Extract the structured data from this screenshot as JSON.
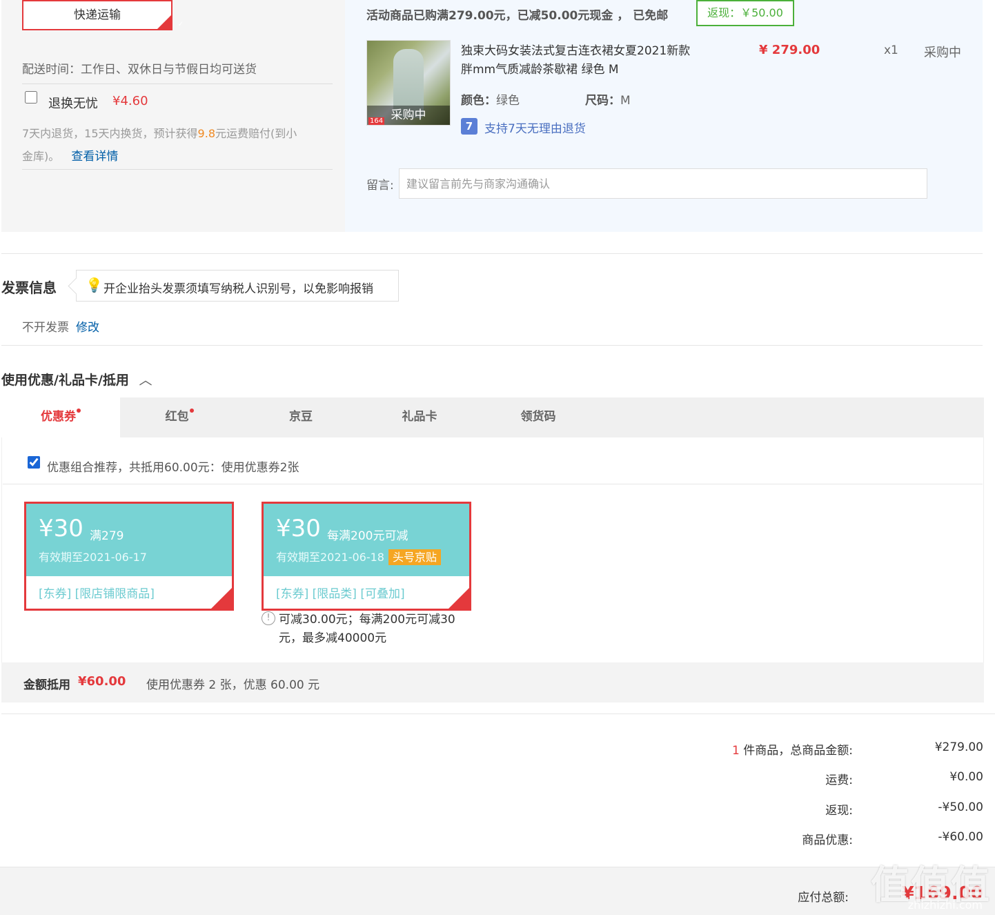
{
  "shipping": {
    "method_label": "快递运输",
    "delivery_time": "配送时间：工作日、双休日与节假日均可送货",
    "return_service_label": "退换无忧",
    "return_service_price": "¥4.60",
    "return_desc_prefix": "7天内退货，15天内换货，预计获得",
    "return_desc_amount": "9.8",
    "return_desc_suffix": "元运费赔付(到小",
    "return_desc_line2": "金库)。",
    "details_link": "查看详情"
  },
  "promo": {
    "title": "活动商品已购满279.00元，已减50.00元现金 ， 已免邮",
    "cashback": "返现：￥50.00"
  },
  "product": {
    "thumb_overlay": "采购中",
    "thumb_tag": "164",
    "name_line1": "独束大码女装法式复古连衣裙女夏2021新款",
    "name_line2": "胖mm气质减龄茶歇裙 绿色 M",
    "price": "¥ 279.00",
    "qty": "x1",
    "status": "采购中",
    "color_label": "颜色：",
    "color_value": "绿色",
    "size_label": "尺码：",
    "size_value": "M",
    "return_badge": "7",
    "return_policy": "支持7天无理由退货"
  },
  "note": {
    "label": "留言:",
    "placeholder": "建议留言前先与商家沟通确认"
  },
  "invoice": {
    "title": "发票信息",
    "tip": "开企业抬头发票须填写纳税人识别号，以免影响报销",
    "status": "不开发票",
    "edit": "修改"
  },
  "discount": {
    "title": "使用优惠/礼品卡/抵用",
    "tabs": [
      "优惠券",
      "红包",
      "京豆",
      "礼品卡",
      "领货码"
    ],
    "combo_text": "优惠组合推荐，共抵用60.00元：使用优惠券2张",
    "coupons": [
      {
        "amount": "¥30",
        "condition": "满279",
        "expiry": "有效期至2021-06-17",
        "labels": "[东券]  [限店铺限商品]"
      },
      {
        "amount": "¥30",
        "condition": "每满200元可减",
        "expiry": "有效期至2021-06-18",
        "flag": "头号京贴",
        "labels": "[东券]  [限品类]  [可叠加]",
        "note_line1": "可减30.00元；每满200元可减30",
        "note_line2": "元，最多减40000元"
      }
    ],
    "summary_label": "金额抵用",
    "summary_amount": "¥60.00",
    "summary_text": "使用优惠券 2 张，优惠 60.00 元"
  },
  "totals": {
    "count": "1",
    "count_label": "件商品，总商品金额:",
    "goods_amount": "¥279.00",
    "shipping_label": "运费:",
    "shipping_amount": "¥0.00",
    "cashback_label": "返现:",
    "cashback_amount": "-¥50.00",
    "discount_label": "商品优惠:",
    "discount_amount": "-¥60.00",
    "payable_label": "应付总额:",
    "payable_amount": "¥169.00"
  },
  "watermark": {
    "main": "值",
    "sub": "zhizhizhi.com"
  }
}
